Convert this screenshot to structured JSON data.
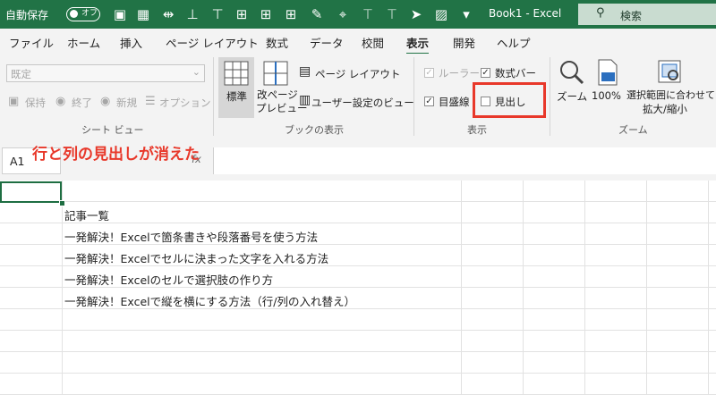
{
  "titlebar": {
    "autosave_label": "自動保存",
    "autosave_state": "オフ",
    "doc_title": "Book1 - Excel",
    "search_label": "検索",
    "accent_color": "#217346"
  },
  "tabs": [
    {
      "label": "ファイル"
    },
    {
      "label": "ホーム"
    },
    {
      "label": "挿入"
    },
    {
      "label": "ページ レイアウト"
    },
    {
      "label": "数式"
    },
    {
      "label": "データ"
    },
    {
      "label": "校閲"
    },
    {
      "label": "表示"
    },
    {
      "label": "開発"
    },
    {
      "label": "ヘルプ"
    }
  ],
  "ribbon": {
    "sheet_view": {
      "dropdown_value": "既定",
      "keep": "保持",
      "exit": "終了",
      "new": "新規",
      "options": "オプション",
      "group_label": "シート ビュー"
    },
    "workbook_views": {
      "normal": "標準",
      "page_break_line1": "改ページ",
      "page_break_line2": "プレビュー",
      "page_layout": "ページ レイアウト",
      "custom_views": "ユーザー設定のビュー",
      "group_label": "ブックの表示"
    },
    "show": {
      "ruler": "ルーラー",
      "formula_bar": "数式バー",
      "gridlines": "目盛線",
      "headings": "見出し",
      "ruler_checked": true,
      "formula_bar_checked": true,
      "gridlines_checked": true,
      "headings_checked": false,
      "group_label": "表示"
    },
    "zoom": {
      "zoom": "ズーム",
      "hundred": "100%",
      "zoom_to_selection_line1": "選択範囲に合わせて",
      "zoom_to_selection_line2": "拡大/縮小",
      "group_label": "ズーム"
    }
  },
  "formula_bar": {
    "name_box": "A1",
    "fx_symbol": "fx",
    "value": ""
  },
  "annotation": {
    "text": "行と列の見出しが消えた",
    "color": "#e8382a"
  },
  "sheet": {
    "cells": [
      "",
      "記事一覧",
      "一発解決！Excelで箇条書きや段落番号を使う方法",
      "一発解決！Excelでセルに決まった文字を入れる方法",
      "一発解決！Excelのセルで選択肢の作り方",
      "一発解決！Excelで縦を横にする方法（行/列の入れ替え）"
    ]
  }
}
